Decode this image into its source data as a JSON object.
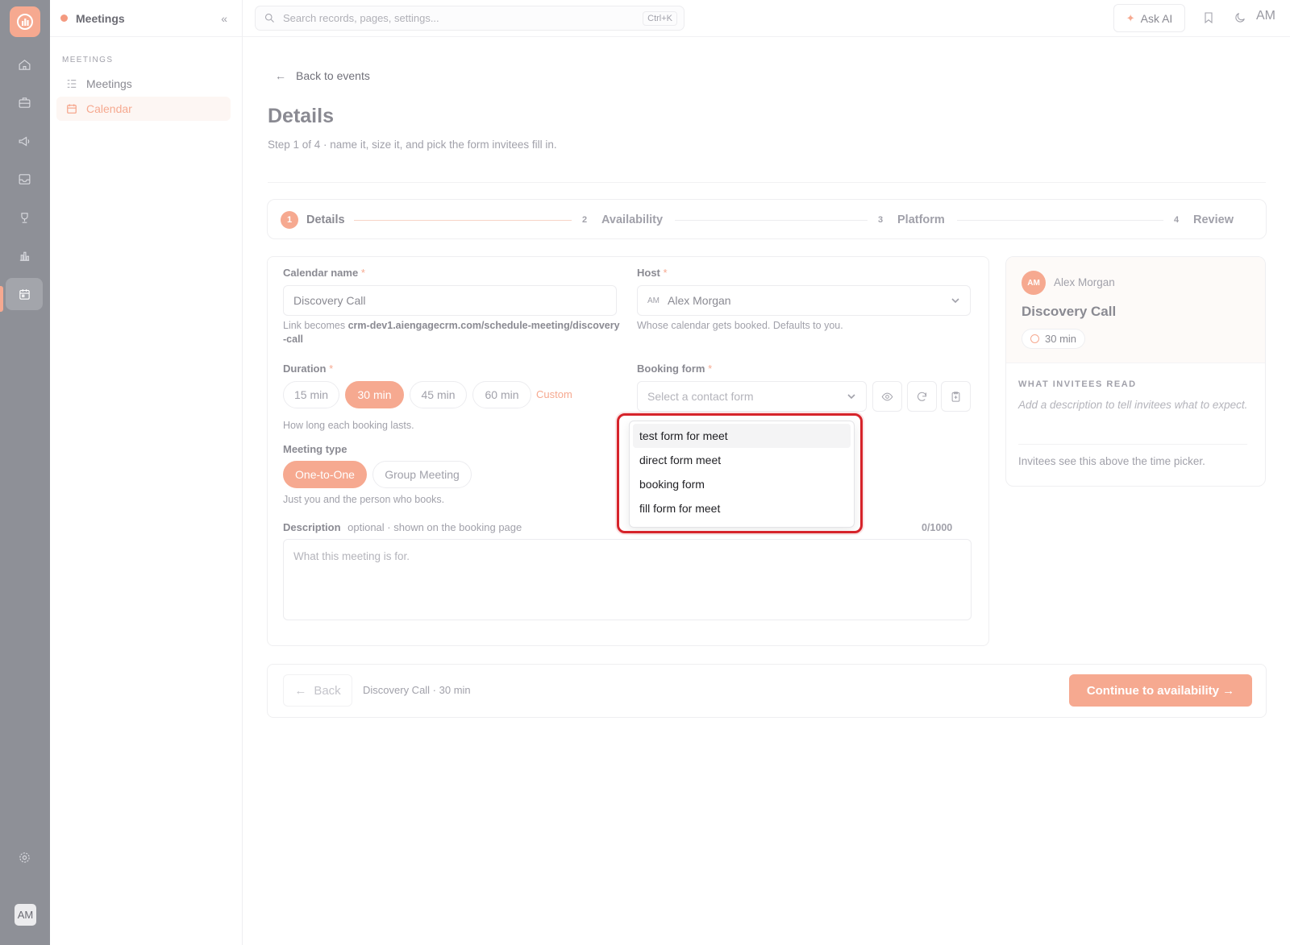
{
  "app": {
    "module_title": "Meetings",
    "user_initials": "AM"
  },
  "sidebar": {
    "section": "MEETINGS",
    "items": [
      {
        "label": "Meetings",
        "icon": "list-icon",
        "active": false
      },
      {
        "label": "Calendar",
        "icon": "calendar-icon",
        "active": true
      }
    ]
  },
  "rail": {
    "icons": [
      "home-icon",
      "briefcase-icon",
      "megaphone-icon",
      "inbox-icon",
      "trophy-icon",
      "chart-icon",
      "calendar-icon",
      "settings-icon"
    ],
    "active": "calendar-icon"
  },
  "topbar": {
    "search_placeholder": "Search records, pages, settings...",
    "shortcut": "Ctrl+K",
    "ask_ai": "Ask AI",
    "avatar": "AM"
  },
  "page": {
    "back_link": "Back to events",
    "title": "Details",
    "subtitle": "Step 1 of 4 · name it, size it, and pick the form invitees fill in."
  },
  "stepper": [
    {
      "num": "1",
      "label": "Details",
      "state": "current"
    },
    {
      "num": "2",
      "label": "Availability",
      "state": "todo"
    },
    {
      "num": "3",
      "label": "Platform",
      "state": "todo"
    },
    {
      "num": "4",
      "label": "Review",
      "state": "todo"
    }
  ],
  "form": {
    "calendar_name": {
      "label": "Calendar name",
      "required": "*",
      "value": "Discovery Call",
      "hint_prefix": "Link becomes ",
      "hint_url": "crm-dev1.aiengagecrm.com/schedule-meeting/discovery-call"
    },
    "host": {
      "label": "Host",
      "required": "*",
      "initials": "AM",
      "value": "Alex Morgan",
      "hint": "Whose calendar gets booked. Defaults to you."
    },
    "duration": {
      "label": "Duration",
      "required": "*",
      "options": [
        "15 min",
        "30 min",
        "45 min",
        "60 min"
      ],
      "selected": "30 min",
      "custom": "Custom",
      "hint": "How long each booking lasts."
    },
    "booking_form": {
      "label": "Booking form",
      "required": "*",
      "placeholder": "Select a contact form",
      "options": [
        "test form for meet",
        "direct form meet",
        "booking form",
        "fill form for meet"
      ],
      "highlighted": "test form for meet"
    },
    "meeting_type": {
      "label": "Meeting type",
      "options": [
        "One-to-One",
        "Group Meeting"
      ],
      "selected": "One-to-One",
      "hint": "Just you and the person who books."
    },
    "description": {
      "label": "Description",
      "note": "optional · shown on the booking page",
      "counter": "0/1000",
      "placeholder": "What this meeting is for."
    }
  },
  "preview": {
    "avatar": "AM",
    "host": "Alex Morgan",
    "title": "Discovery Call",
    "duration": "30 min",
    "section": "WHAT INVITEES READ",
    "description_placeholder": "Add a description to tell invitees what to expect.",
    "footer": "Invitees see this above the time picker."
  },
  "footer": {
    "back": "Back",
    "summary": "Discovery Call · 30 min",
    "continue": "Continue to availability →"
  },
  "colors": {
    "accent": "#f6a990",
    "highlight_ring": "#d6232a",
    "rail_bg": "#8e9097"
  }
}
